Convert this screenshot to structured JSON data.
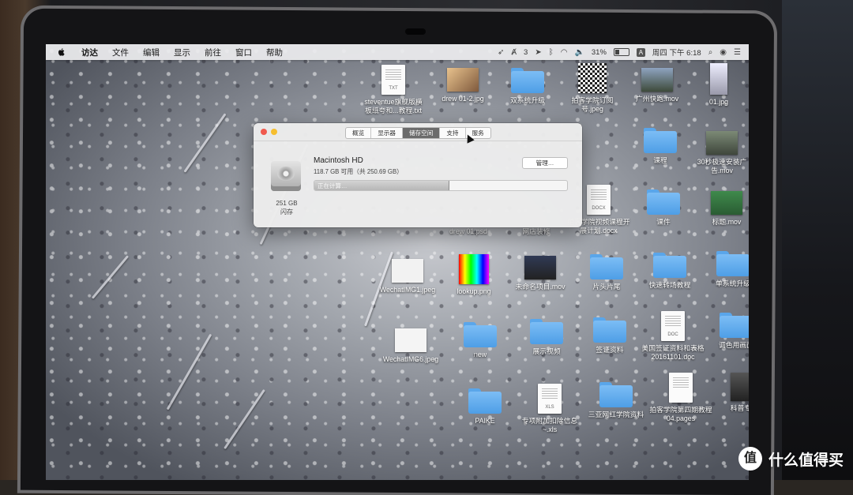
{
  "menubar": {
    "items": [
      "访达",
      "文件",
      "编辑",
      "显示",
      "前往",
      "窗口",
      "帮助"
    ],
    "status": {
      "app_badge": "3",
      "battery": "31%",
      "input": "A",
      "clock": "周四 下午 6:18"
    }
  },
  "window": {
    "tabs": [
      "概览",
      "显示器",
      "储存空间",
      "支持",
      "服务"
    ],
    "active_tab": "储存空间",
    "disk_name": "Macintosh HD",
    "disk_available": "118.7 GB 可用（共 250.69 GB）",
    "usage_text": "正在计算…",
    "usage_fraction": 0.53,
    "manage_label": "管理…",
    "disk_size": "251 GB",
    "disk_type": "闪存"
  },
  "desktop": {
    "icons": [
      {
        "label": "steventue旗舰版横\n板纸夸和...教程.txt",
        "kind": "doc",
        "tag": "TXT"
      },
      {
        "label": "drew 01-2.jpg",
        "kind": "image"
      },
      {
        "label": "双系统升级",
        "kind": "folder"
      },
      {
        "label": "拍客学院订阅\n号.jpeg",
        "kind": "qr"
      },
      {
        "label": "广州快跑.mov",
        "kind": "image"
      },
      {
        "label": "01.jpg",
        "kind": "image"
      },
      {
        "label": "课程",
        "kind": "folder"
      },
      {
        "label": "30秒极速安装广\n告.mov",
        "kind": "image"
      },
      {
        "label": "拍客学院视频课程开\n展计划.docx",
        "kind": "doc",
        "tag": "DOCX"
      },
      {
        "label": "课件",
        "kind": "folder"
      },
      {
        "label": "标题.mov",
        "kind": "image"
      },
      {
        "label": "drew 01.psd",
        "kind": "none"
      },
      {
        "label": "网店装修",
        "kind": "none"
      },
      {
        "label": "WechatIMG1.jpeg",
        "kind": "image"
      },
      {
        "label": "lookup.png",
        "kind": "image"
      },
      {
        "label": "未命名项目.mov",
        "kind": "image"
      },
      {
        "label": "片头片尾",
        "kind": "folder"
      },
      {
        "label": "快速转场教程",
        "kind": "folder"
      },
      {
        "label": "单系统升级",
        "kind": "folder"
      },
      {
        "label": "WechatIMG6.jpeg",
        "kind": "image"
      },
      {
        "label": "new",
        "kind": "folder"
      },
      {
        "label": "展示视频",
        "kind": "folder"
      },
      {
        "label": "签证资料",
        "kind": "folder"
      },
      {
        "label": "美国签证资料和表格\n20161101.doc",
        "kind": "doc",
        "tag": "DOC"
      },
      {
        "label": "调色用画面",
        "kind": "folder"
      },
      {
        "label": "PAIKE",
        "kind": "folder"
      },
      {
        "label": "专项附加扣除信息\n~.xls",
        "kind": "doc",
        "tag": "XLS"
      },
      {
        "label": "三亚网红学院资料",
        "kind": "folder"
      },
      {
        "label": "拍客学院第四期教程\n04.pages",
        "kind": "doc",
        "tag": ""
      },
      {
        "label": "科普专",
        "kind": "image"
      }
    ]
  },
  "watermark": {
    "badge": "值",
    "text": "什么值得买"
  },
  "colors": {
    "folder": "#5aa6ea",
    "traffic_red": "#f05a4e",
    "traffic_yellow": "#f6be2f"
  }
}
